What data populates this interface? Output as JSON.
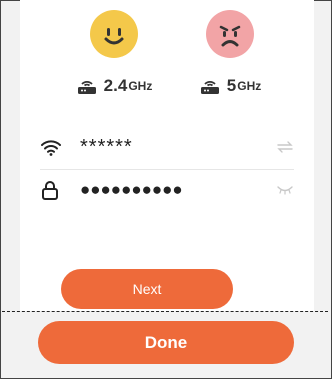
{
  "bands": [
    {
      "main": "2.4",
      "unit": "GHz",
      "status": "good",
      "face_color": "#f4c84a"
    },
    {
      "main": "5",
      "unit": "GHz",
      "status": "bad",
      "face_color": "#f2a4a6"
    }
  ],
  "wifi": {
    "ssid_value": "******",
    "password_value": "●●●●●●●●●●",
    "icons": {
      "ssid": "wifi-icon",
      "password": "lock-icon",
      "ssid_action": "switch-icon",
      "password_action": "eye-closed-icon"
    }
  },
  "buttons": {
    "next_label": "Next",
    "done_label": "Done"
  },
  "colors": {
    "accent": "#ee6a3a",
    "panel_bg": "#ffffff",
    "page_bg": "#f2f2f2"
  }
}
